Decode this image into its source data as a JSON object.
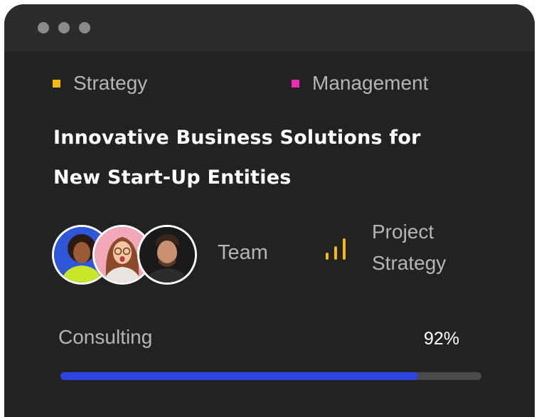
{
  "window": {
    "dots": [
      "dot",
      "dot",
      "dot"
    ]
  },
  "tags": [
    {
      "label": "Strategy",
      "color": "#f5b90f"
    },
    {
      "label": "Management",
      "color": "#ee2bb5"
    }
  ],
  "headline": {
    "line1": "Innovative Business Solutions for",
    "line2": "New Start-Up Entities"
  },
  "team": {
    "label": "Team",
    "avatars": [
      "avatar-woman-blue-background",
      "avatar-woman-pink-background",
      "avatar-man-dark-background"
    ]
  },
  "project": {
    "icon": "signal-bars-icon",
    "icon_color": "#f5b90f",
    "label_line1": "Project",
    "label_line2": "Strategy"
  },
  "progress": {
    "label": "Consulting",
    "percent_text": "92%",
    "value": 0.85,
    "fill_color": "#2b45e0"
  }
}
